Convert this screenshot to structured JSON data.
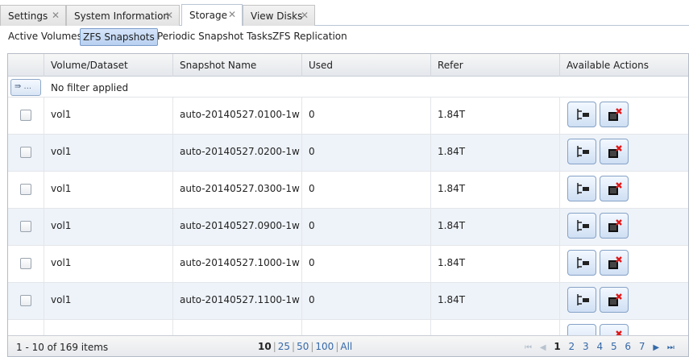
{
  "tabs": [
    {
      "label": "Settings"
    },
    {
      "label": "System Information"
    },
    {
      "label": "Storage"
    },
    {
      "label": "View Disks"
    }
  ],
  "subtabs": [
    {
      "label": "Active Volumes"
    },
    {
      "label": "ZFS Snapshots"
    },
    {
      "label": "Periodic Snapshot Tasks"
    },
    {
      "label": "ZFS Replication"
    }
  ],
  "grid": {
    "headers": {
      "volume": "Volume/Dataset",
      "snapshot": "Snapshot Name",
      "used": "Used",
      "refer": "Refer",
      "actions": "Available Actions"
    },
    "filter_button": "⇛ ...",
    "filter_text": "No filter applied",
    "rows": [
      {
        "volume": "vol1",
        "snapshot": "auto-20140527.0100-1w",
        "used": "0",
        "refer": "1.84T"
      },
      {
        "volume": "vol1",
        "snapshot": "auto-20140527.0200-1w",
        "used": "0",
        "refer": "1.84T"
      },
      {
        "volume": "vol1",
        "snapshot": "auto-20140527.0300-1w",
        "used": "0",
        "refer": "1.84T"
      },
      {
        "volume": "vol1",
        "snapshot": "auto-20140527.0900-1w",
        "used": "0",
        "refer": "1.84T"
      },
      {
        "volume": "vol1",
        "snapshot": "auto-20140527.1000-1w",
        "used": "0",
        "refer": "1.84T"
      },
      {
        "volume": "vol1",
        "snapshot": "auto-20140527.1100-1w",
        "used": "0",
        "refer": "1.84T"
      }
    ]
  },
  "footer": {
    "count": "1 - 10 of 169 items",
    "page_sizes": [
      "10",
      "25",
      "50",
      "100",
      "All"
    ],
    "pages": [
      "1",
      "2",
      "3",
      "4",
      "5",
      "6",
      "7"
    ]
  },
  "colors": {
    "accent": "#3569a8",
    "row_alt": "#eef3f9",
    "delete_red": "#e01818"
  },
  "icons": {
    "row_action_1": "clone-snapshot-icon",
    "row_action_2": "destroy-snapshot-icon",
    "filter": "filter-icon"
  }
}
